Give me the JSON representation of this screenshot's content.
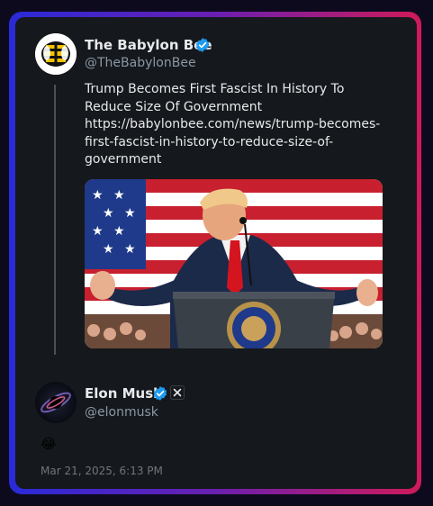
{
  "colors": {
    "background": "#0d0a1e",
    "card": "#15181c",
    "verified": "#1d9bf0",
    "border_left": "#2a2ad8",
    "border_right": "#d01a5a"
  },
  "quoted_tweet": {
    "author_name": "The Babylon Bee",
    "author_handle": "@TheBabylonBee",
    "verified_icon": "verified-badge-icon",
    "text_lines": [
      "Trump Becomes First Fascist In History To",
      "Reduce Size Of Government",
      "https://babylonbee.com/news/trump-becomes-",
      "first-fascist-in-history-to-reduce-size-of-",
      "government"
    ],
    "media": "photo"
  },
  "reply_tweet": {
    "author_name": "Elon Musk",
    "author_handle": "@elonmusk",
    "verified_icon": "verified-badge-icon",
    "affiliate_icon": "x-logo-icon",
    "text": "😂",
    "timestamp": "Mar 21, 2025, 6:13 PM"
  }
}
